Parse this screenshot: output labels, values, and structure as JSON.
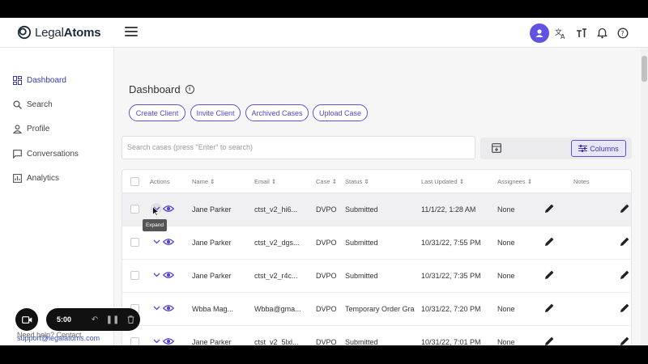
{
  "brand": {
    "name_regular": "Legal",
    "name_bold": "Atoms"
  },
  "header": {
    "icons": [
      "account-icon",
      "translate-icon",
      "text-size-icon",
      "notification-bell-icon",
      "help-icon"
    ]
  },
  "sidebar": {
    "items": [
      {
        "label": "Dashboard",
        "icon": "dashboard-icon",
        "active": true
      },
      {
        "label": "Search",
        "icon": "search-icon"
      },
      {
        "label": "Profile",
        "icon": "profile-icon"
      },
      {
        "label": "Conversations",
        "icon": "conversations-icon"
      },
      {
        "label": "Analytics",
        "icon": "analytics-icon"
      }
    ],
    "help_text": "Need help? Contact",
    "help_email": "support@legalatoms.com"
  },
  "main": {
    "title": "Dashboard",
    "buttons": [
      "Create Client",
      "Invite Client",
      "Archived Cases",
      "Upload Case"
    ],
    "search_placeholder": "Search cases (press \"Enter\" to search)",
    "columns_label": "Columns"
  },
  "table": {
    "headers": [
      "Actions",
      "Name",
      "Email",
      "Case",
      "Status",
      "Last Updated",
      "Assignees",
      "Notes"
    ],
    "rows": [
      {
        "name": "Jane Parker",
        "email": "ctst_v2_hi6...",
        "case": "DVPO",
        "status": "Submitted",
        "updated": "11/1/22, 1:28 AM",
        "assignees": "None"
      },
      {
        "name": "Jane Parker",
        "email": "ctst_v2_dgs...",
        "case": "DVPO",
        "status": "Submitted",
        "updated": "10/31/22, 7:55 PM",
        "assignees": "None"
      },
      {
        "name": "Jane Parker",
        "email": "ctst_v2_r4c...",
        "case": "DVPO",
        "status": "Submitted",
        "updated": "10/31/22, 7:35 PM",
        "assignees": "None"
      },
      {
        "name": "Wbba Mag...",
        "email": "Wbba@gma...",
        "case": "DVPO",
        "status": "Temporary Order Gra",
        "updated": "10/31/22, 7:20 PM",
        "assignees": "None"
      },
      {
        "name": "Jane Parker",
        "email": "ctst_v2_5lxl...",
        "case": "DVPO",
        "status": "Submitted",
        "updated": "10/31/22, 7:01 PM",
        "assignees": "None"
      }
    ],
    "tooltip": "Expand"
  },
  "recorder": {
    "time": "5:00"
  },
  "colors": {
    "accent": "#5b4fd6",
    "link": "#3c53c7"
  }
}
